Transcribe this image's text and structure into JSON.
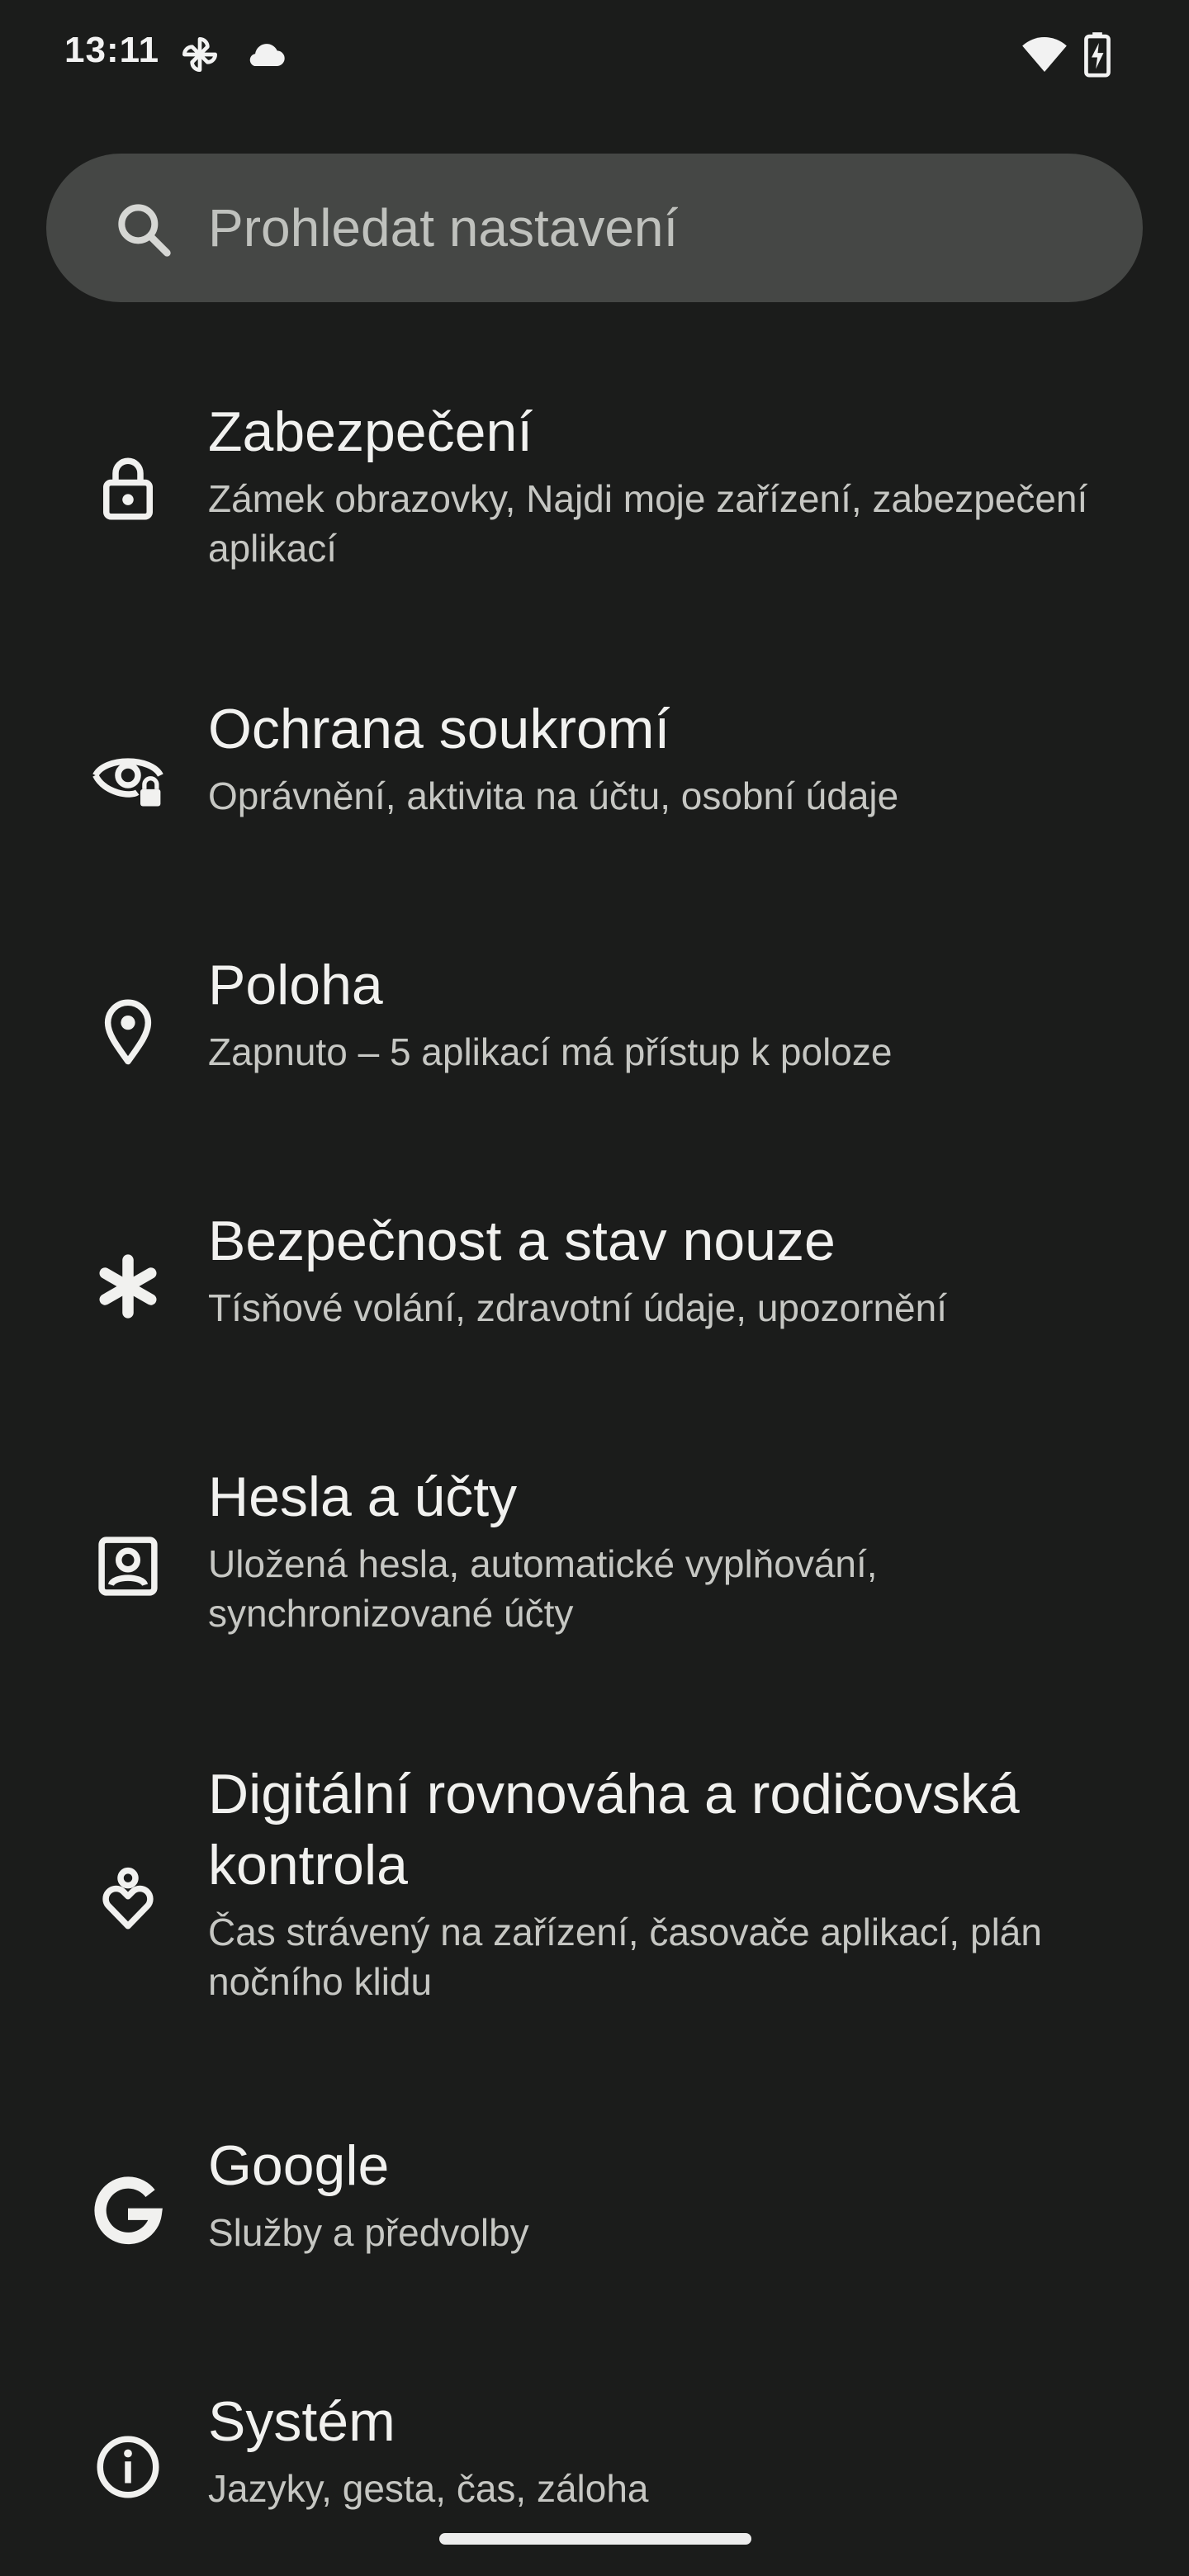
{
  "status_bar": {
    "time": "13:11",
    "icons": [
      "pinwheel-icon",
      "cloud-icon",
      "wifi-icon",
      "battery-charging-icon"
    ]
  },
  "search": {
    "placeholder": "Prohledat nastavení",
    "icon": "search-icon"
  },
  "settings": [
    {
      "icon": "lock-icon",
      "title": "Zabezpečení",
      "subtitle": "Zámek obrazovky, Najdi moje zařízení, zabezpečení aplikací"
    },
    {
      "icon": "privacy-eye-lock-icon",
      "title": "Ochrana soukromí",
      "subtitle": "Oprávnění, aktivita na účtu, osobní údaje"
    },
    {
      "icon": "location-pin-icon",
      "title": "Poloha",
      "subtitle": "Zapnuto – 5 aplikací má přístup k poloze"
    },
    {
      "icon": "asterisk-icon",
      "title": "Bezpečnost a stav nouze",
      "subtitle": "Tísňové volání, zdravotní údaje, upozornění"
    },
    {
      "icon": "account-box-icon",
      "title": "Hesla a účty",
      "subtitle": "Uložená hesla, automatické vyplňování, synchronizované účty"
    },
    {
      "icon": "digital-wellbeing-icon",
      "title": "Digitální rovnováha a rodičovská kontrola",
      "subtitle": "Čas strávený na zařízení, časovače aplikací, plán nočního klidu"
    },
    {
      "icon": "google-g-icon",
      "title": "Google",
      "subtitle": "Služby a předvolby"
    },
    {
      "icon": "info-icon",
      "title": "Systém",
      "subtitle": "Jazyky, gesta, čas, záloha"
    }
  ]
}
